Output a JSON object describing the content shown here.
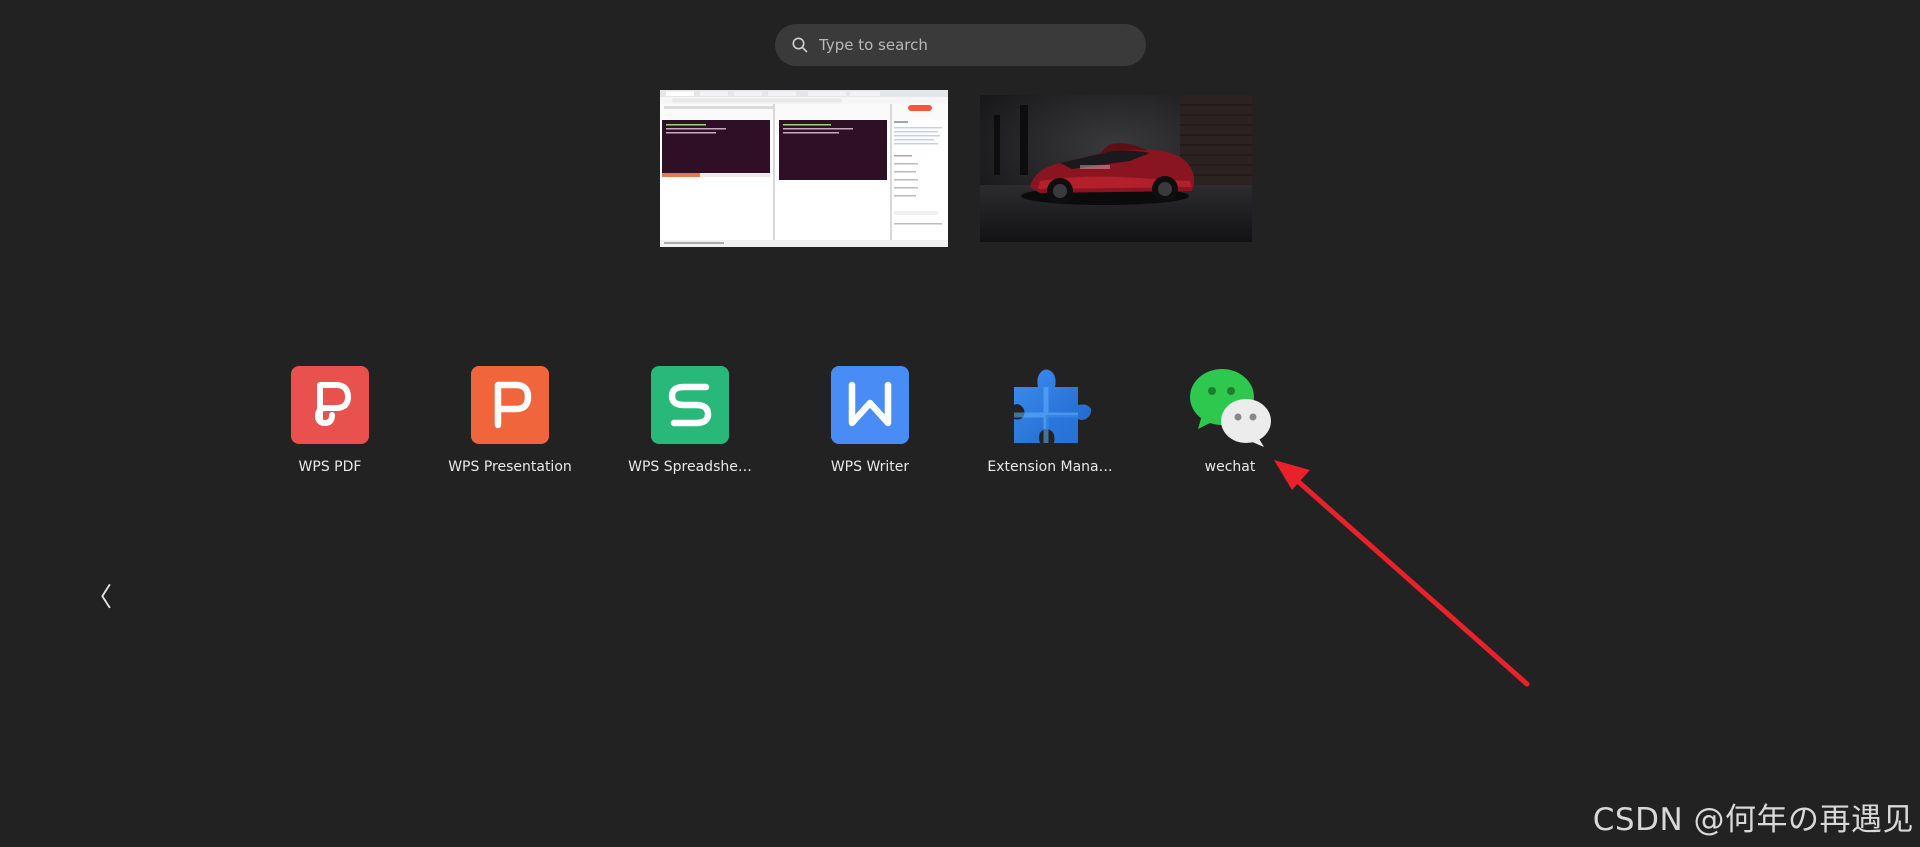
{
  "search": {
    "placeholder": "Type to search"
  },
  "apps": [
    {
      "label": "WPS PDF",
      "icon": "wps-pdf-icon"
    },
    {
      "label": "WPS Presentation",
      "icon": "wps-presentation-icon"
    },
    {
      "label": "WPS Spreadshe…",
      "icon": "wps-spreadsheet-icon"
    },
    {
      "label": "WPS Writer",
      "icon": "wps-writer-icon"
    },
    {
      "label": "Extension Mana…",
      "icon": "extension-manager-icon"
    },
    {
      "label": "wechat",
      "icon": "wechat-icon"
    }
  ],
  "nav": {
    "prev": "〈"
  },
  "watermark": "CSDN @何年の再遇见",
  "colors": {
    "background": "#222222",
    "annotation_arrow": "#e8212a",
    "wps_pdf": "#e9514f",
    "wps_presentation": "#f0653c",
    "wps_spreadsheet": "#27b87a",
    "wps_writer": "#4a8cf5",
    "wechat_green": "#2dc84d"
  }
}
